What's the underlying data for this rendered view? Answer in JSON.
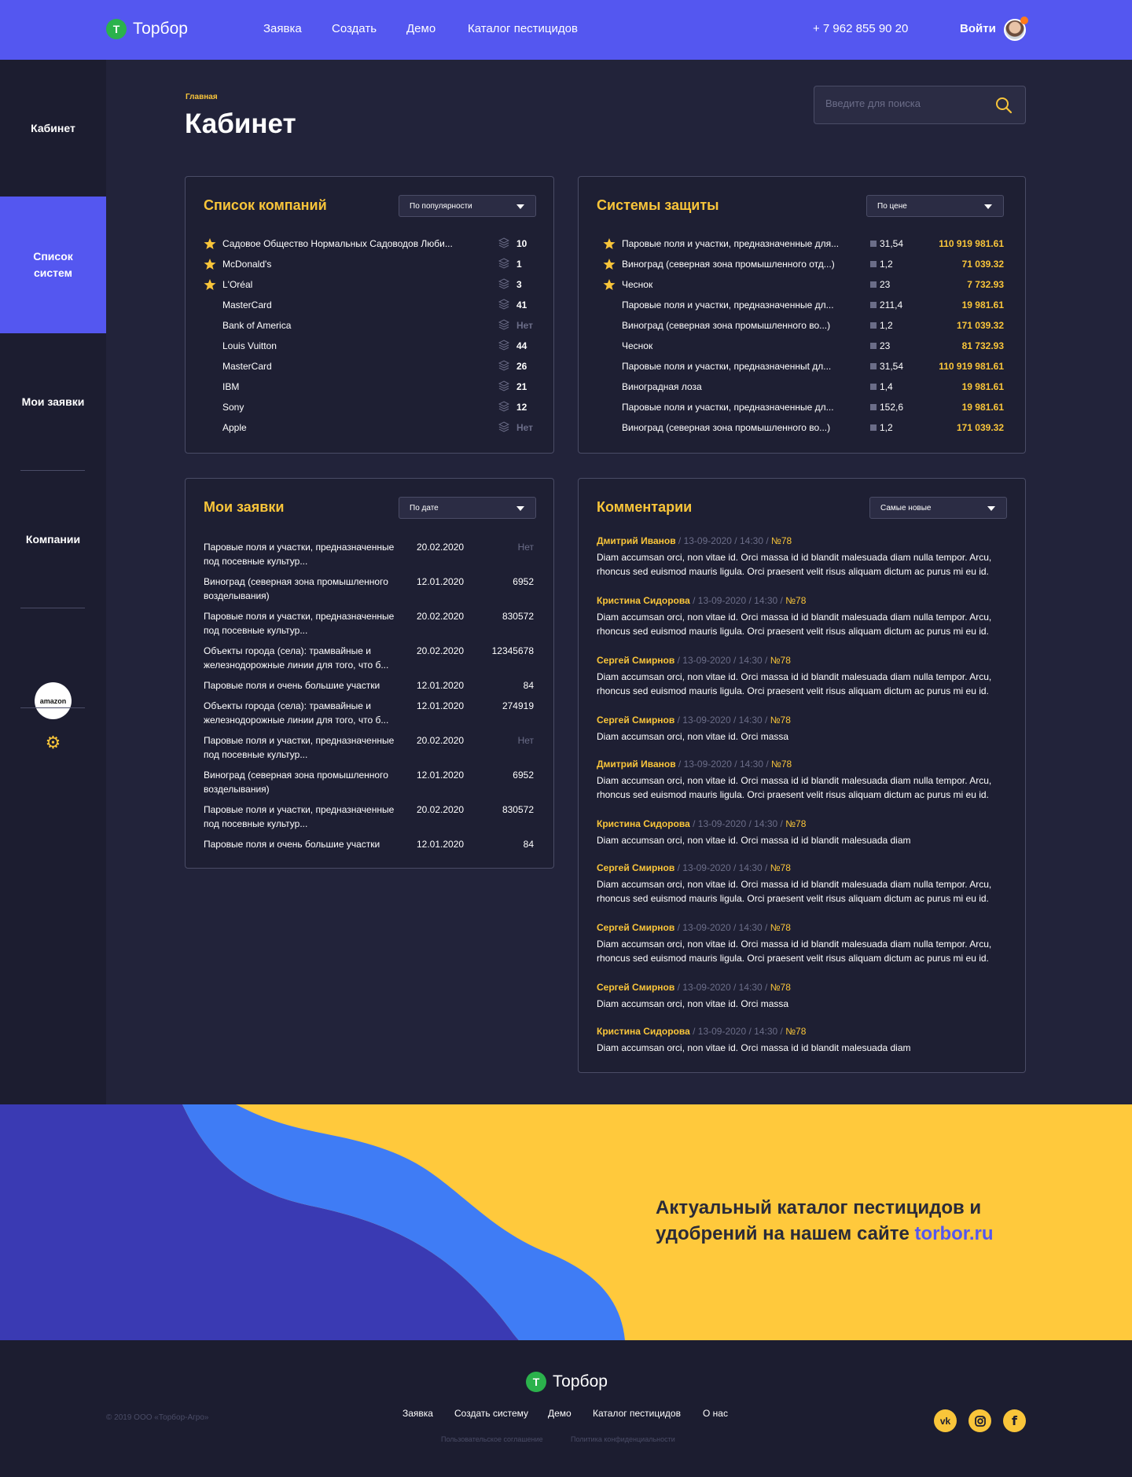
{
  "brand": {
    "name": "Торбор",
    "mark": "Т"
  },
  "header": {
    "nav": [
      "Заявка",
      "Создать",
      "Демо",
      "Каталог пестицидов"
    ],
    "phone": "+ 7 962 855 90 20",
    "login": "Войти"
  },
  "sidebar": {
    "items": [
      "Кабинет",
      "Список систем",
      "Мои заявки",
      "Компании"
    ],
    "active": "Список систем",
    "company_logo": "amazon",
    "settings_icon": "gear-icon"
  },
  "page": {
    "breadcrumb": "Главная",
    "title": "Кабинет",
    "search_placeholder": "Введите для поиска"
  },
  "companies": {
    "title": "Список компаний",
    "sort": "По популярности",
    "rows": [
      {
        "name": "Садовое Общество Нормальных Садоводов Люби...",
        "count": "10",
        "starred": true
      },
      {
        "name": "McDonald's",
        "count": "1",
        "starred": true
      },
      {
        "name": "L'Oréal",
        "count": "3",
        "starred": true
      },
      {
        "name": "MasterCard",
        "count": "41",
        "starred": false
      },
      {
        "name": "Bank of America",
        "count": "Нет",
        "starred": false
      },
      {
        "name": "Louis Vuitton",
        "count": "44",
        "starred": false
      },
      {
        "name": "MasterCard",
        "count": "26",
        "starred": false
      },
      {
        "name": "IBM",
        "count": "21",
        "starred": false
      },
      {
        "name": "Sony",
        "count": "12",
        "starred": false
      },
      {
        "name": "Apple",
        "count": "Нет",
        "starred": false
      }
    ]
  },
  "systems": {
    "title": "Системы защиты",
    "sort": "По цене",
    "rows": [
      {
        "name": "Паровые поля и участки, предназначенные для...",
        "area": "31,54",
        "price": "110 919 981.61",
        "starred": true
      },
      {
        "name": "Виноград (северная зона промышленного отд...)",
        "area": "1,2",
        "price": "71 039.32",
        "starred": true
      },
      {
        "name": "Чеснок",
        "area": "23",
        "price": "7 732.93",
        "starred": true
      },
      {
        "name": "Паровые поля и участки, предназначенные дл...",
        "area": "211,4",
        "price": "19 981.61",
        "starred": false
      },
      {
        "name": "Виноград (северная зона промышленного во...)",
        "area": "1,2",
        "price": "171 039.32",
        "starred": false
      },
      {
        "name": "Чеснок",
        "area": "23",
        "price": "81 732.93",
        "starred": false
      },
      {
        "name": "Паровые поля и участки, предназначенныt дл...",
        "area": "31,54",
        "price": "110 919 981.61",
        "starred": false
      },
      {
        "name": "Виноградная лоза",
        "area": "1,4",
        "price": "19 981.61",
        "starred": false
      },
      {
        "name": "Паровые поля и участки, предназначенные дл...",
        "area": "152,6",
        "price": "19 981.61",
        "starred": false
      },
      {
        "name": "Виноград (северная зона промышленного во...)",
        "area": "1,2",
        "price": "171 039.32",
        "starred": false
      }
    ]
  },
  "applications": {
    "title": "Мои заявки",
    "sort": "По дате",
    "rows": [
      {
        "name": "Паровые поля и участки, предназначенные под посевные культур...",
        "date": "20.02.2020",
        "value": "Нет"
      },
      {
        "name": "Виноград (северная зона промышленного возделывания)",
        "date": "12.01.2020",
        "value": "6952"
      },
      {
        "name": "Паровые поля и участки, предназначенные под посевные культур...",
        "date": "20.02.2020",
        "value": "830572"
      },
      {
        "name": "Объекты города (села): трамвайные и железнодорожные линии для того, что б...",
        "date": "20.02.2020",
        "value": "12345678"
      },
      {
        "name": "Паровые поля и очень большие участки",
        "date": "12.01.2020",
        "value": "84"
      },
      {
        "name": "Объекты города (села): трамвайные и железнодорожные линии для того, что б...",
        "date": "12.01.2020",
        "value": "274919"
      },
      {
        "name": "Паровые поля и участки, предназначенные под посевные культур...",
        "date": "20.02.2020",
        "value": "Нет"
      },
      {
        "name": "Виноград (северная зона промышленного возделывания)",
        "date": "12.01.2020",
        "value": "6952"
      },
      {
        "name": "Паровые поля и участки, предназначенные под посевные культур...",
        "date": "20.02.2020",
        "value": "830572"
      },
      {
        "name": "Паровые поля и очень большие участки",
        "date": "12.01.2020",
        "value": "84"
      }
    ]
  },
  "comments": {
    "title": "Комментарии",
    "sort": "Самые новые",
    "items": [
      {
        "author": "Дмитрий Иванов",
        "meta": " / 13-09-2020 / 14:30 / ",
        "no": "№78",
        "text": "Diam accumsan orci, non vitae id. Orci massa id id blandit malesuada diam nulla tempor. Arcu, rhoncus sed euismod mauris ligula. Orci praesent velit risus aliquam dictum ac purus mi eu id."
      },
      {
        "author": "Кристина Сидорова",
        "meta": " / 13-09-2020 / 14:30 / ",
        "no": "№78",
        "text": "Diam accumsan orci, non vitae id. Orci massa id id blandit malesuada diam nulla tempor. Arcu, rhoncus sed euismod mauris ligula. Orci praesent velit risus aliquam dictum ac purus mi eu id."
      },
      {
        "author": "Сергей Смирнов",
        "meta": " / 13-09-2020 / 14:30 / ",
        "no": "№78",
        "text": "Diam accumsan orci, non vitae id. Orci massa id id blandit malesuada diam nulla tempor. Arcu, rhoncus sed euismod mauris ligula. Orci praesent velit risus aliquam dictum ac purus mi eu id."
      },
      {
        "author": "Сергей Смирнов",
        "meta": " / 13-09-2020 / 14:30 / ",
        "no": "№78",
        "text": "Diam accumsan orci, non vitae id. Orci massa"
      },
      {
        "author": "Дмитрий Иванов",
        "meta": " / 13-09-2020 / 14:30 / ",
        "no": "№78",
        "text": "Diam accumsan orci, non vitae id. Orci massa id id blandit malesuada diam nulla tempor. Arcu, rhoncus sed euismod mauris ligula. Orci praesent velit risus aliquam dictum ac purus mi eu id."
      },
      {
        "author": "Кристина Сидорова",
        "meta": " / 13-09-2020 / 14:30 / ",
        "no": "№78",
        "text": "Diam accumsan orci, non vitae id. Orci massa id id blandit malesuada diam"
      },
      {
        "author": "Сергей Смирнов",
        "meta": " / 13-09-2020 / 14:30 / ",
        "no": "№78",
        "text": "Diam accumsan orci, non vitae id. Orci massa id id blandit malesuada diam nulla tempor. Arcu, rhoncus sed euismod mauris ligula. Orci praesent velit risus aliquam dictum ac purus mi eu id."
      },
      {
        "author": "Сергей Смирнов",
        "meta": " / 13-09-2020 / 14:30 / ",
        "no": "№78",
        "text": "Diam accumsan orci, non vitae id. Orci massa id id blandit malesuada diam nulla tempor. Arcu, rhoncus sed euismod mauris ligula. Orci praesent velit risus aliquam dictum ac purus mi eu id."
      },
      {
        "author": "Сергей Смирнов",
        "meta": " / 13-09-2020 / 14:30 / ",
        "no": "№78",
        "text": "Diam accumsan orci, non vitae id. Orci massa"
      },
      {
        "author": "Кристина Сидорова",
        "meta": " / 13-09-2020 / 14:30 / ",
        "no": "№78",
        "text": "Diam accumsan orci, non vitae id. Orci massa id id blandit malesuada diam"
      }
    ]
  },
  "banner": {
    "text": "Актуальный каталог пестицидов и удобрений на нашем сайте ",
    "link": "torbor.ru"
  },
  "footer": {
    "copyright": "© 2019 ООО «Торбор-Агро»",
    "nav": [
      "Заявка",
      "Создать систему",
      "Демо",
      "Каталог пестицидов",
      "О нас"
    ],
    "legal": [
      "Пользовательское соглашение",
      "Политика конфиденциальности"
    ],
    "social": [
      "vk-icon",
      "instagram-icon",
      "facebook-icon"
    ]
  },
  "colors": {
    "accent": "#5457f0",
    "highlight": "#f9c53a",
    "background": "#22233a",
    "banner": "#ffc93c"
  }
}
